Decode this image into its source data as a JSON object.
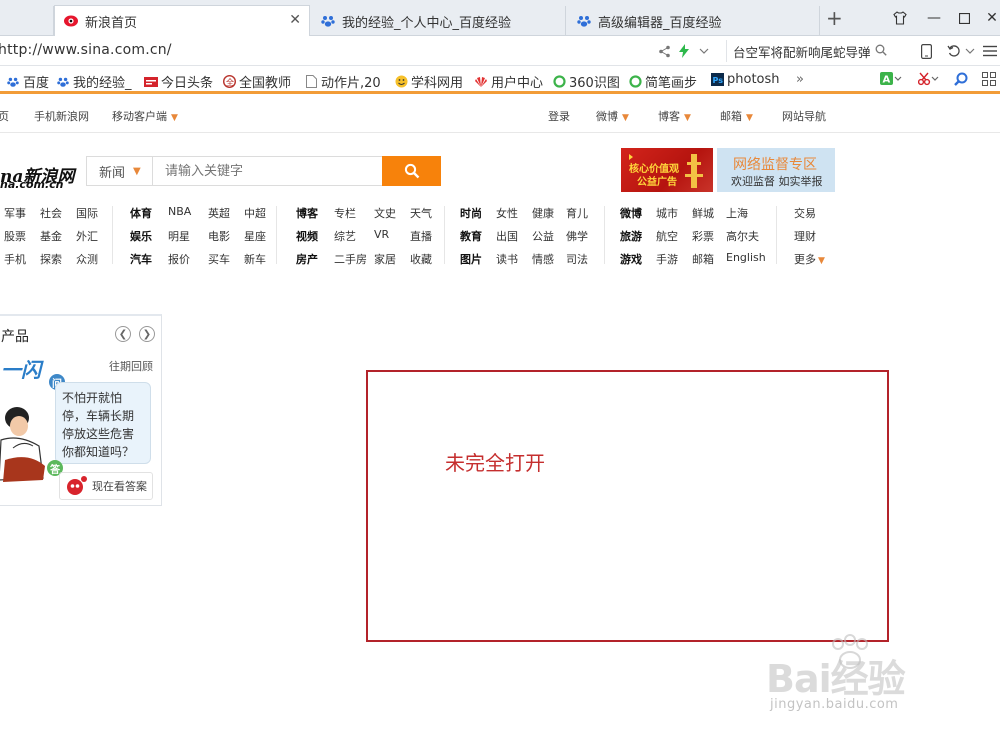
{
  "tabs": [
    {
      "title": "新浪首页",
      "active": true
    },
    {
      "title": "我的经验_个人中心_百度经验",
      "active": false
    },
    {
      "title": "高级编辑器_百度经验",
      "active": false
    }
  ],
  "address": {
    "url": "http://www.sina.com.cn/",
    "search_text": "台空军将配新响尾蛇导弹"
  },
  "bookmarks": [
    {
      "label": "百度",
      "icon": "paw-icon"
    },
    {
      "label": "我的经验_",
      "icon": "paw-icon"
    },
    {
      "label": "今日头条",
      "icon": "news-icon"
    },
    {
      "label": "全国教师",
      "icon": "badge-icon"
    },
    {
      "label": "动作片,20",
      "icon": "page-icon"
    },
    {
      "label": "学科网用",
      "icon": "smile-icon"
    },
    {
      "label": "用户中心",
      "icon": "huawei-icon"
    },
    {
      "label": "360识图",
      "icon": "circle-icon"
    },
    {
      "label": "简笔画步",
      "icon": "circle-icon"
    },
    {
      "label": "photosh",
      "icon": "ps-icon"
    }
  ],
  "bookmarks_more": "»",
  "sina_nav": {
    "left": [
      "页",
      "手机新浪网",
      "移动客户端"
    ],
    "right": [
      "登录",
      "微博",
      "博客",
      "邮箱",
      "网站导航"
    ]
  },
  "logo": {
    "text": "na新浪网",
    "sub": "na.com.cn"
  },
  "search": {
    "category": "新闻",
    "placeholder": "请输入关键字"
  },
  "banners": {
    "b1_text": [
      "核心价值观",
      "公益广告"
    ],
    "b2_title": "网络监督专区",
    "b2_sub": "欢迎监督 如实举报"
  },
  "categories": {
    "col1": [
      [
        "军事",
        "社会",
        "国际"
      ],
      [
        "股票",
        "基金",
        "外汇"
      ],
      [
        "手机",
        "探索",
        "众测"
      ]
    ],
    "col2": [
      [
        "体育",
        "NBA",
        "英超",
        "中超"
      ],
      [
        "娱乐",
        "明星",
        "电影",
        "星座"
      ],
      [
        "汽车",
        "报价",
        "买车",
        "新车"
      ]
    ],
    "col3": [
      [
        "博客",
        "专栏",
        "文史",
        "天气"
      ],
      [
        "视频",
        "综艺",
        "VR",
        "直播"
      ],
      [
        "房产",
        "二手房",
        "家居",
        "收藏"
      ]
    ],
    "col4": [
      [
        "时尚",
        "女性",
        "健康",
        "育儿"
      ],
      [
        "教育",
        "出国",
        "公益",
        "佛学"
      ],
      [
        "图片",
        "读书",
        "情感",
        "司法"
      ]
    ],
    "col5": [
      [
        "微博",
        "城市",
        "鲜城",
        "上海"
      ],
      [
        "旅游",
        "航空",
        "彩票",
        "高尔夫"
      ],
      [
        "游戏",
        "手游",
        "邮箱",
        "English"
      ]
    ],
    "col6": [
      [
        "交易"
      ],
      [
        "理财"
      ],
      [
        "更多"
      ]
    ]
  },
  "widget": {
    "title": "产品",
    "past": "往期回顾",
    "question": "不怕开就怕停，车辆长期停放这些危害你都知道吗？",
    "q_badge": "问",
    "a_badge": "答",
    "answer_btn": "现在看答案"
  },
  "annotation": {
    "text": "未完全打开"
  },
  "watermark": {
    "main": "Bai经验",
    "sub": "jingyan.baidu.com"
  },
  "colors": {
    "accent": "#f7820b",
    "annotation": "#b3232a",
    "bookmark_border": "#f29c38"
  }
}
